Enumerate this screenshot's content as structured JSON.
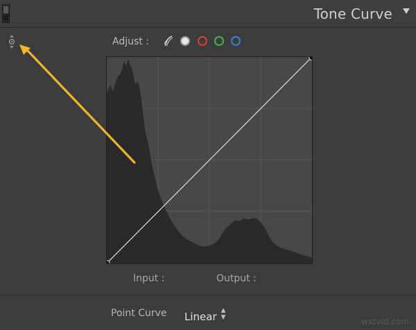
{
  "panel": {
    "title": "Tone Curve",
    "collapse_icon": "triangle-down-icon",
    "toggle_icon": "panel-switch-icon"
  },
  "adjust": {
    "label": "Adjust :",
    "channels": [
      {
        "name": "region-curve",
        "icon": "region-curve-icon"
      },
      {
        "name": "rgb",
        "icon": "rgb-channel-icon",
        "selected": true
      },
      {
        "name": "red",
        "color": "#d64040"
      },
      {
        "name": "green",
        "color": "#45b34a"
      },
      {
        "name": "blue",
        "color": "#3d7fd6"
      }
    ]
  },
  "target_tool": {
    "icon": "targeted-adjustment-icon"
  },
  "graph": {
    "curve": "linear",
    "histogram_icon": "histogram",
    "gridlines": true
  },
  "io": {
    "input_label": "Input :",
    "output_label": "Output :"
  },
  "point_curve": {
    "label": "Point Curve",
    "value": "Linear",
    "icon": "up-down-arrows-icon"
  },
  "annotation": {
    "arrow_color": "#f0b62e"
  },
  "watermark": "wxtvid.com"
}
